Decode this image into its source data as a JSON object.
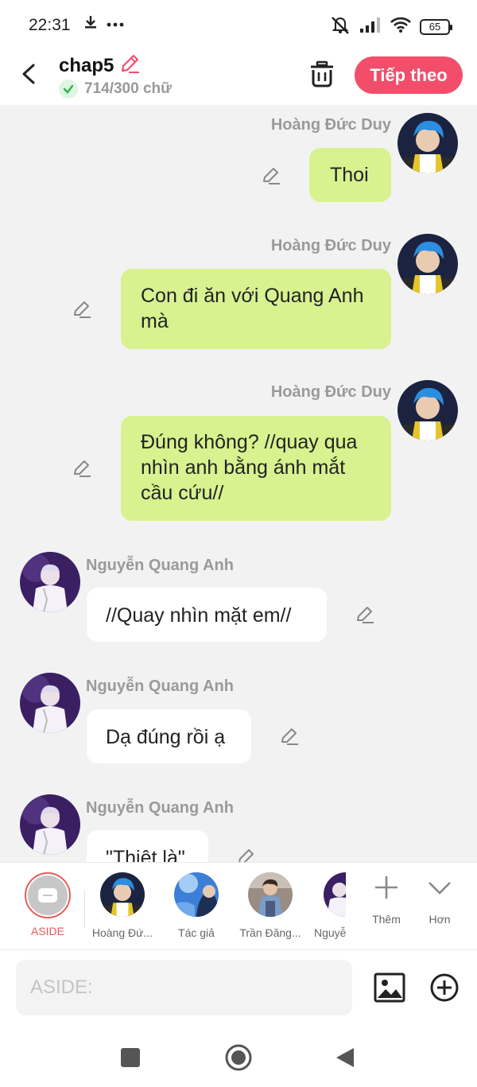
{
  "status": {
    "time": "22:31",
    "battery": "65"
  },
  "header": {
    "title": "chap5",
    "word_count": "714/300 chữ",
    "next_label": "Tiếp theo"
  },
  "colors": {
    "accent": "#f24e6b",
    "right_bubble": "#d7f28f",
    "left_bubble": "#ffffff",
    "aside_ring": "#e65a5a"
  },
  "messages": [
    {
      "side": "right",
      "author": "Hoàng Đức Duy",
      "text": "Thoi"
    },
    {
      "side": "right",
      "author": "Hoàng Đức Duy",
      "text": "Con đi ăn với Quang Anh mà"
    },
    {
      "side": "right",
      "author": "Hoàng Đức Duy",
      "text": "Đúng không? //quay qua nhìn anh bằng ánh mắt cầu cứu//"
    },
    {
      "side": "left",
      "author": "Nguyễn Quang Anh",
      "text": "//Quay nhìn mặt em//"
    },
    {
      "side": "left",
      "author": "Nguyễn Quang Anh",
      "text": "Dạ đúng rồi ạ"
    },
    {
      "side": "left",
      "author": "Nguyễn Quang Anh",
      "text": "\"Thiệt là\""
    }
  ],
  "characters": [
    {
      "label": "ASIDE"
    },
    {
      "label": "Hoàng Đứ..."
    },
    {
      "label": "Tác giả"
    },
    {
      "label": "Trần Đăng..."
    },
    {
      "label": "Nguyễ"
    }
  ],
  "tools": {
    "more_label": "Thêm",
    "expand_label": "Hơn"
  },
  "input": {
    "placeholder": "ASIDE:"
  }
}
